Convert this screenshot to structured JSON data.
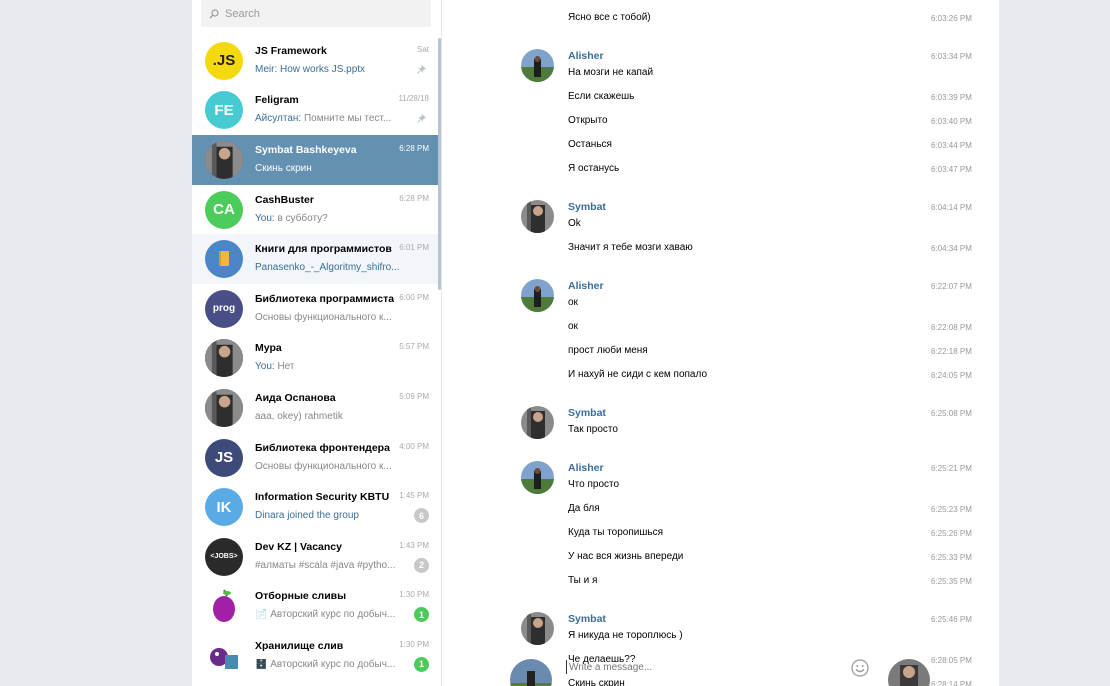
{
  "search": {
    "placeholder": "Search"
  },
  "chats": [
    {
      "name": "JS Framework",
      "time": "Sat",
      "sender": "Meir:",
      "preview": "How works JS.pptx",
      "preview_link": true,
      "pinned": true,
      "avatar_text": ".JS",
      "avatar_color": "#f5d90f",
      "avatar_text_color": "#222"
    },
    {
      "name": "Feligram",
      "time": "11/28/18",
      "sender": "Айсултан:",
      "preview": "Помните мы тест...",
      "pinned": true,
      "avatar_text": "FE",
      "avatar_color": "#45cbd1"
    },
    {
      "name": "Symbat Bashkeyeva",
      "time": "6:28 PM",
      "sender": "",
      "preview": "Скинь скрин",
      "active": true,
      "avatar_text": "",
      "avatar_color": "#5b5b5b"
    },
    {
      "name": "CashBuster",
      "time": "6:28 PM",
      "sender": "You:",
      "preview": "в субботу?",
      "avatar_text": "CA",
      "avatar_color": "#4ccc5b"
    },
    {
      "name": "Книги для программистов",
      "time": "6:01 PM",
      "sender": "",
      "preview": "Panasenko_-_Algoritmy_shifro...",
      "preview_link": true,
      "hover": true,
      "avatar_text": "",
      "avatar_color": "#4b86c7"
    },
    {
      "name": "Библиотека программиста",
      "time": "6:00 PM",
      "sender": "",
      "preview": "Основы функционального к...",
      "avatar_text": "prog",
      "avatar_color": "#4a4e86"
    },
    {
      "name": "Мура",
      "time": "5:57 PM",
      "sender": "You:",
      "preview": "Нет",
      "avatar_text": "",
      "avatar_color": "#3b3b3b"
    },
    {
      "name": "Аида Оспанова",
      "time": "5:09 PM",
      "sender": "",
      "preview": "aaa, okey) rahmetik",
      "avatar_text": "",
      "avatar_color": "#2c2c2c"
    },
    {
      "name": "Библиотека фронтендера",
      "time": "4:00 PM",
      "sender": "",
      "preview": "Основы функционального к...",
      "avatar_text": "JS",
      "avatar_color": "#3d4a7a"
    },
    {
      "name": "Information Security KBTU",
      "time": "1:45 PM",
      "sender": "",
      "preview": "Dinara joined the group",
      "preview_link": true,
      "badge": "6",
      "badge_style": "muted",
      "avatar_text": "IK",
      "avatar_color": "#5aaae6"
    },
    {
      "name": "Dev KZ | Vacancy",
      "time": "1:43 PM",
      "sender": "",
      "preview": "#алматы #scala #java #pytho...",
      "badge": "2",
      "badge_style": "muted",
      "avatar_text": "<JOBS>",
      "avatar_color": "#2a2a2a"
    },
    {
      "name": "Отборные сливы",
      "time": "1:30 PM",
      "sender": "",
      "preview": "📄 Авторский курс по добыч...",
      "badge": "1",
      "badge_style": "green",
      "avatar_text": "",
      "avatar_color": "#ffffff"
    },
    {
      "name": "Хранилище слив",
      "time": "1:30 PM",
      "sender": "",
      "preview": "🗄️ Авторский курс по добыч...",
      "badge": "1",
      "badge_style": "green",
      "avatar_text": "",
      "avatar_color": "#ffffff"
    }
  ],
  "messages": [
    {
      "text": "Ясно все с тобой)",
      "time": "6:03:26 PM"
    },
    {
      "sender": "Alisher",
      "avatar": "alisher",
      "text": "На мозги не капай",
      "time": "6:03:34 PM"
    },
    {
      "text": "Если скажешь",
      "time": "6:03:39 PM"
    },
    {
      "text": "Открыто",
      "time": "6:03:40 PM"
    },
    {
      "text": "Останься",
      "time": "6:03:44 PM"
    },
    {
      "text": "Я останусь",
      "time": "6:03:47 PM"
    },
    {
      "sender": "Symbat",
      "avatar": "symbat",
      "text": "Ok",
      "time": "6:04:14 PM"
    },
    {
      "text": "Значит я тебе мозги хаваю",
      "time": "6:04:34 PM"
    },
    {
      "sender": "Alisher",
      "avatar": "alisher",
      "text": "ок",
      "time": "6:22:07 PM"
    },
    {
      "text": "ок",
      "time": "6:22:08 PM"
    },
    {
      "text": "прост люби меня",
      "time": "6:22:18 PM"
    },
    {
      "text": "И нахуй не сиди с кем попало",
      "time": "6:24:05 PM"
    },
    {
      "sender": "Symbat",
      "avatar": "symbat",
      "text": "Так просто",
      "time": "6:25:08 PM"
    },
    {
      "sender": "Alisher",
      "avatar": "alisher",
      "text": "Что просто",
      "time": "6:25:21 PM"
    },
    {
      "text": "Да бля",
      "time": "6:25:23 PM"
    },
    {
      "text": "Куда ты торопишься",
      "time": "6:25:26 PM"
    },
    {
      "text": "У нас вся жизнь впереди",
      "time": "6:25:33 PM"
    },
    {
      "text": "Ты и я",
      "time": "6:25:35 PM"
    },
    {
      "sender": "Symbat",
      "avatar": "symbat",
      "text": "Я никуда не тороплюсь )",
      "time": "6:25:46 PM"
    },
    {
      "text": "Че делаешь??",
      "time": "6:28:05 PM"
    },
    {
      "text": "Скинь скрин",
      "time": "6:28:14 PM"
    }
  ],
  "composer": {
    "placeholder": "Write a message..."
  },
  "colors": {
    "accent": "#6490b1",
    "link": "#3a6d99",
    "background": "#e7ebf0"
  }
}
